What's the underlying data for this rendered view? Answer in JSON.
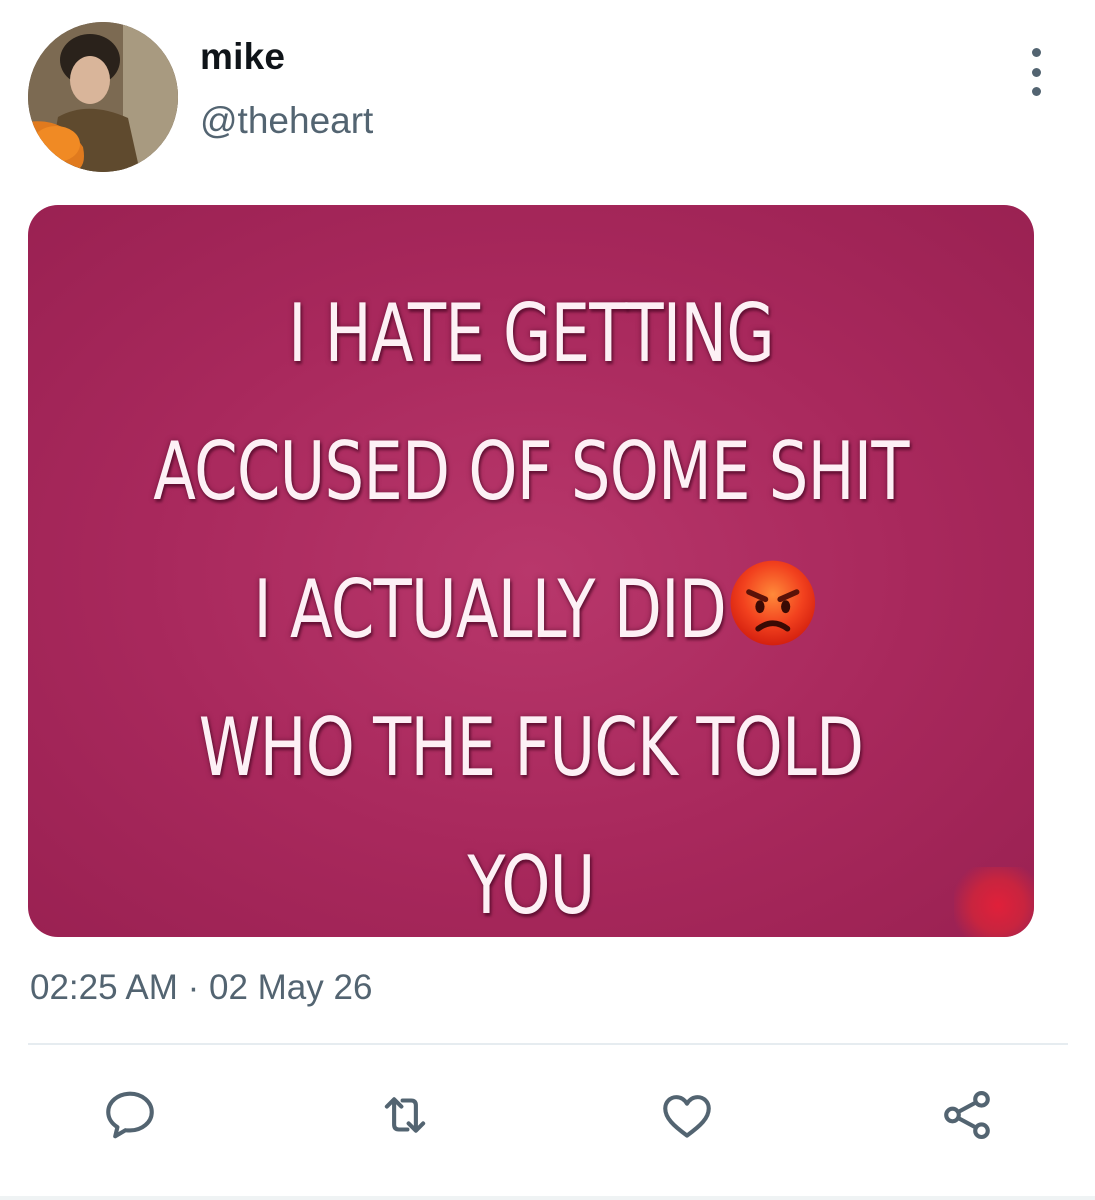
{
  "tweet": {
    "author": {
      "display_name": "mike",
      "handle": "@theheart"
    },
    "media": {
      "lines": [
        "I HATE GETTING",
        "ACCUSED OF SOME SHIT",
        "I ACTUALLY DID",
        "WHO THE FUCK TOLD",
        "YOU"
      ],
      "emoji": "angry-face-icon",
      "background_color": "#a8285c",
      "text_color": "#fdf0f5"
    },
    "timestamp": "02:25 AM · 02 May 26"
  },
  "actions": [
    {
      "name": "reply",
      "icon": "reply-icon"
    },
    {
      "name": "retweet",
      "icon": "retweet-icon"
    },
    {
      "name": "like",
      "icon": "heart-icon"
    },
    {
      "name": "share",
      "icon": "share-icon"
    }
  ],
  "colors": {
    "secondary_text": "#536471",
    "primary_text": "#0f1419",
    "divider": "#e6ecf0"
  }
}
